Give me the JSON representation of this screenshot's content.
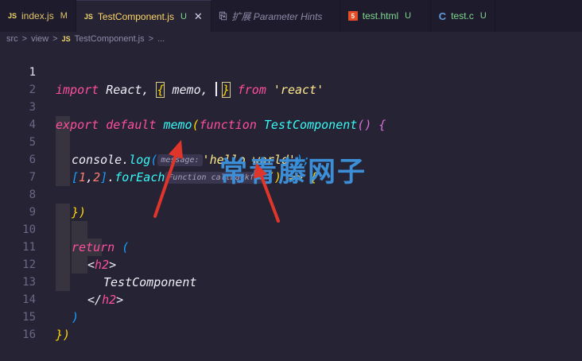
{
  "tabs": [
    {
      "icon": "JS",
      "label": "index.js",
      "badge": "M"
    },
    {
      "icon": "JS",
      "label": "TestComponent.js",
      "badge": "U",
      "close": "✕"
    },
    {
      "icon": "⎘",
      "label": "扩展 Parameter Hints"
    },
    {
      "icon": "5",
      "label": "test.html",
      "badge": "U"
    },
    {
      "icon": "C",
      "label": "test.c",
      "badge": "U"
    }
  ],
  "breadcrumb": {
    "src": "src",
    "sep": ">",
    "view": "view",
    "icon": "JS",
    "file": "TestComponent.js",
    "more": "..."
  },
  "line_numbers": [
    "1",
    "2",
    "3",
    "4",
    "5",
    "6",
    "7",
    "8",
    "9",
    "10",
    "11",
    "12",
    "13",
    "14",
    "15",
    "16"
  ],
  "code": {
    "l1_import": "import",
    "l1_react": " React, ",
    "l1_lbrace": "{",
    "l1_memo": " memo, ",
    "l1_rbrace": "}",
    "l1_from": " from ",
    "l1_str": "'react'",
    "l3_export": "export default ",
    "l3_memo": "memo",
    "l3_paren": "(",
    "l3_function": "function ",
    "l3_name": "TestComponent",
    "l3_args": "()",
    "l3_brace": " {",
    "l5_console": "console.",
    "l5_log": "log",
    "l5_paren": "(",
    "l5_hint": "message:",
    "l5_str": "'hello world'",
    "l5_close": ");",
    "l6_bracket_open": "[",
    "l6_one": "1",
    "l6_comma": ",",
    "l6_two": "2",
    "l6_bracket_close": "]",
    "l6_dot": ".",
    "l6_foreach": "forEach",
    "l6_hint": "Function callbackfn:",
    "l6_args": "()",
    "l6_arrow": " => ",
    "l6_brace": "{",
    "l8_close": "})",
    "l10_return": "return ",
    "l10_paren": "(",
    "l11_open": "<",
    "l11_tag": "h2",
    "l11_gt": ">",
    "l12_text": "TestComponent",
    "l13_open": "</",
    "l13_tag": "h2",
    "l13_gt": ">",
    "l14_paren": ")",
    "l15_close": "})"
  },
  "watermark": "常青藤网子",
  "colors": {
    "background": "#262335",
    "arrow": "#e0352b",
    "watermark": "#3c8fd6"
  }
}
